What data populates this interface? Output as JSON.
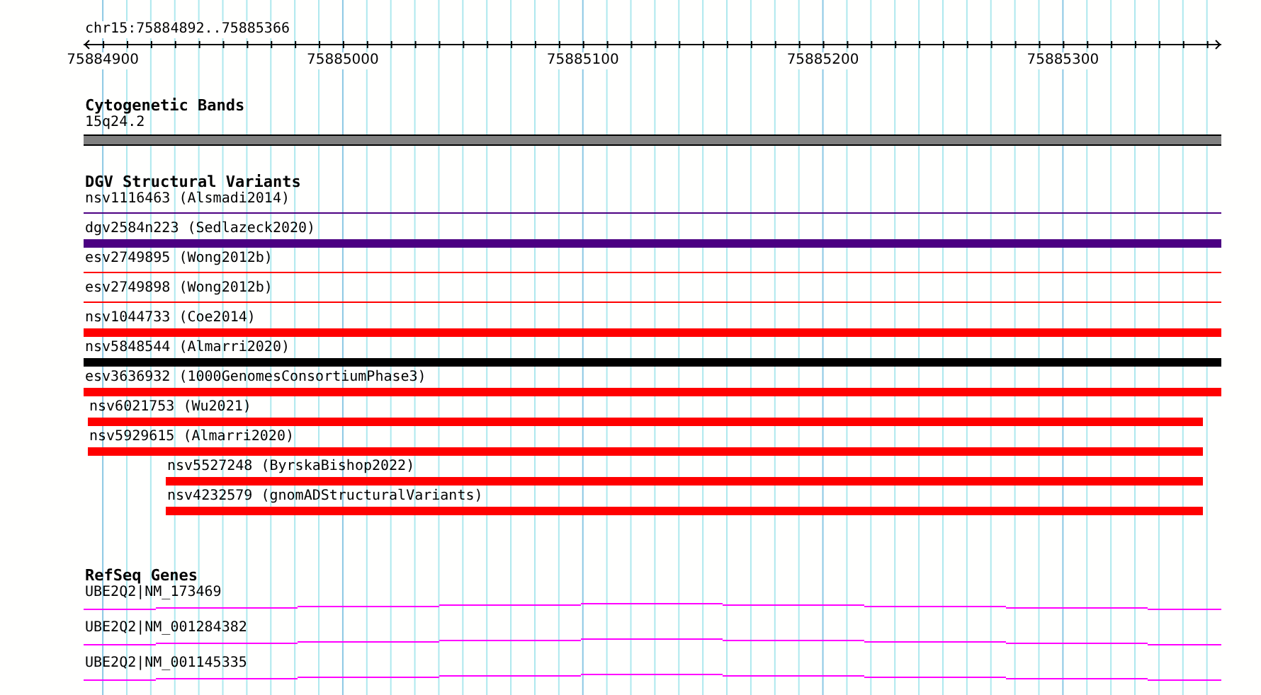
{
  "ruler": {
    "region": "chr15:75884892..75885366",
    "ticks": [
      "75884900",
      "75885000",
      "75885100",
      "75885200",
      "75885300"
    ]
  },
  "cytogenetic_bands": {
    "title": "Cytogenetic Bands",
    "band": "15q24.2"
  },
  "dgv_structural_variants": {
    "title": "DGV Structural Variants",
    "variants": [
      {
        "label": "nsv1116463 (Alsmadi2014)",
        "kind": "line",
        "color": "#4b0082",
        "clipped_left": true,
        "clipped_right": true,
        "indented": false
      },
      {
        "label": "dgv2584n223 (Sedlazeck2020)",
        "kind": "bar",
        "color": "#4b0082",
        "clipped_left": true,
        "clipped_right": true,
        "indented": false
      },
      {
        "label": "esv2749895 (Wong2012b)",
        "kind": "line",
        "color": "#ff0000",
        "clipped_left": true,
        "clipped_right": true,
        "indented": false
      },
      {
        "label": "esv2749898 (Wong2012b)",
        "kind": "line",
        "color": "#ff0000",
        "clipped_left": true,
        "clipped_right": true,
        "indented": false
      },
      {
        "label": "nsv1044733 (Coe2014)",
        "kind": "bar",
        "color": "#ff0000",
        "clipped_left": true,
        "clipped_right": true,
        "indented": false
      },
      {
        "label": "nsv5848544 (Almarri2020)",
        "kind": "bar",
        "color": "#000000",
        "clipped_left": true,
        "clipped_right": true,
        "indented": false
      },
      {
        "label": "esv3636932 (1000GenomesConsortiumPhase3)",
        "kind": "bar",
        "color": "#ff0000",
        "clipped_left": true,
        "clipped_right": true,
        "indented": false
      },
      {
        "label": "nsv6021753 (Wu2021)",
        "kind": "bar",
        "color": "#ff0000",
        "clipped_left": false,
        "clipped_right": false,
        "indented": false
      },
      {
        "label": "nsv5929615 (Almarri2020)",
        "kind": "bar",
        "color": "#ff0000",
        "clipped_left": false,
        "clipped_right": false,
        "indented": false
      },
      {
        "label": "nsv5527248 (ByrskaBishop2022)",
        "kind": "bar",
        "color": "#ff0000",
        "clipped_left": false,
        "clipped_right": false,
        "indented": true
      },
      {
        "label": "nsv4232579 (gnomADStructuralVariants)",
        "kind": "bar",
        "color": "#ff0000",
        "clipped_left": false,
        "clipped_right": false,
        "indented": true
      }
    ]
  },
  "refseq_genes": {
    "title": "RefSeq Genes",
    "genes": [
      {
        "label": "UBE2Q2|NM_173469"
      },
      {
        "label": "UBE2Q2|NM_001284382"
      },
      {
        "label": "UBE2Q2|NM_001145335"
      }
    ]
  }
}
